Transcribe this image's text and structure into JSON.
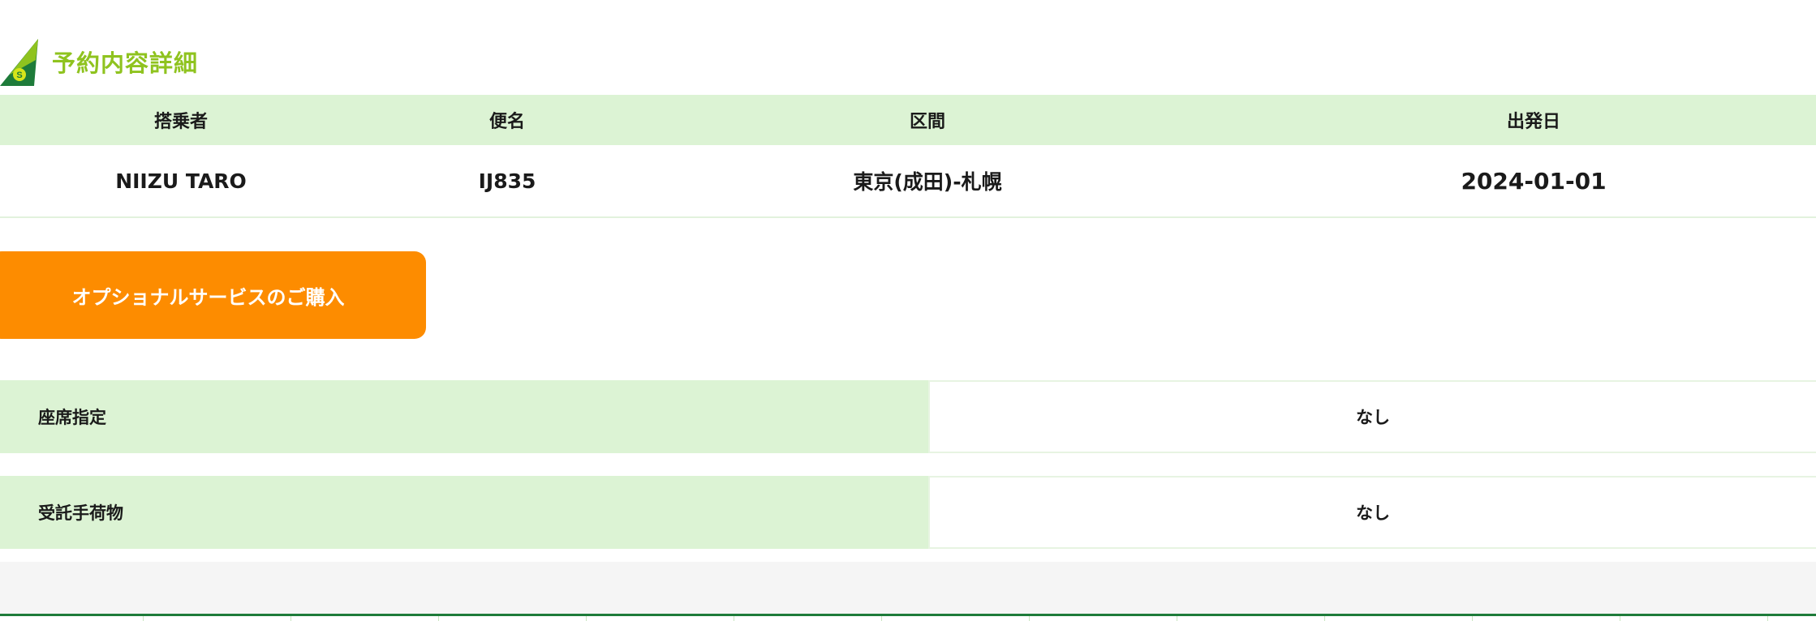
{
  "section": {
    "title": "予約内容詳細",
    "logo_icon": "airline-tail-logo-icon"
  },
  "summary": {
    "headers": {
      "passenger": "搭乗者",
      "flight": "便名",
      "route": "区間",
      "date": "出発日"
    },
    "row": {
      "passenger": "NIIZU TARO",
      "flight": "IJ835",
      "route": "東京(成田)-札幌",
      "date": "2024-01-01"
    }
  },
  "options": {
    "button_label": "オプショナルサービスのご購入",
    "seat": {
      "label": "座席指定",
      "value": "なし"
    },
    "baggage": {
      "label": "受託手荷物",
      "value": "なし"
    }
  },
  "colors": {
    "brand_green": "#8fc31f",
    "dark_green": "#1e7b3a",
    "header_bg": "#dcf3d4",
    "button_orange": "#fd8c00"
  }
}
